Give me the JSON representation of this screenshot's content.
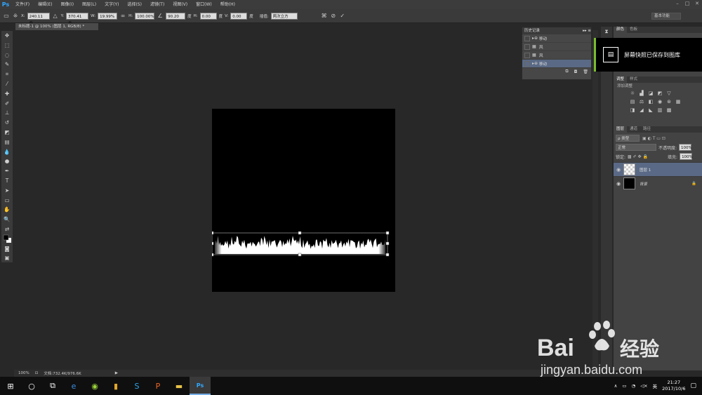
{
  "menubar": {
    "logo": "Ps",
    "items": [
      "文件(F)",
      "编辑(E)",
      "图像(I)",
      "图层(L)",
      "文字(Y)",
      "选择(S)",
      "滤镜(T)",
      "视图(V)",
      "窗口(W)",
      "帮助(H)"
    ],
    "controls": [
      "–",
      "□",
      "✕"
    ]
  },
  "options": {
    "x_label": "X:",
    "x_value": "240.11 像",
    "y_label": "Y:",
    "y_value": "370.41 像",
    "w_label": "W:",
    "w_value": "19.99%",
    "h_label": "H:",
    "h_value": "100.00%",
    "angle_value": "90.20",
    "angle_unit": "度",
    "hskew_label": "H:",
    "hskew_value": "0.00",
    "hskew_unit": "度",
    "vskew_label": "V:",
    "vskew_value": "0.00",
    "vskew_unit": "度",
    "interp_label": "插值:",
    "interp_value": "两次立方",
    "workspace": "基本功能"
  },
  "document": {
    "tab_title": "未标题-1 @ 100% (图层 1, RGB/8) *",
    "zoom": "100%",
    "doc_size": "文档:732.4K/976.6K"
  },
  "history": {
    "title": "历史记录",
    "items": [
      {
        "label": "移动",
        "icon": "move-icon",
        "selected": false
      },
      {
        "label": "风",
        "icon": "wind-filter-icon",
        "selected": false
      },
      {
        "label": "风",
        "icon": "wind-filter-icon",
        "selected": false
      },
      {
        "label": "移动",
        "icon": "move-icon",
        "selected": true
      }
    ]
  },
  "notification": {
    "text": "屏幕快照已保存到图库"
  },
  "panels": {
    "color_tab": "颜色",
    "swatches_tab": "色板",
    "adjust_tab": "调整",
    "styles_tab": "样式",
    "add_adjustment": "添加调整",
    "layers_tab": "图层",
    "channels_tab": "通道",
    "paths_tab": "路径",
    "kind_filter": "ρ 类型",
    "blend_mode": "正常",
    "opacity_label": "不透明度:",
    "opacity_value": "100%",
    "lock_label": "锁定:",
    "fill_label": "填充:",
    "fill_value": "100%"
  },
  "layers": [
    {
      "name": "图层 1",
      "selected": true,
      "thumb": "transparent"
    },
    {
      "name": "背景",
      "selected": false,
      "thumb": "black",
      "locked": true
    }
  ],
  "taskbar": {
    "apps": [
      "start-icon",
      "cortana-icon",
      "task-view-icon",
      "edge-icon",
      "qq-browser-icon",
      "folder-app-icon",
      "skype-icon",
      "wps-icon",
      "file-explorer-icon",
      "photoshop-icon"
    ],
    "ime": "英",
    "time": "21:27",
    "date": "2017/10/6"
  },
  "watermark": {
    "brand_latin": "Bai",
    "brand_cn": "经验",
    "url": "jingyan.baidu.com"
  },
  "colors": {
    "accent": "#31a8ff",
    "selection": "#5a6a86",
    "notify_bar": "#7bbb2e"
  }
}
